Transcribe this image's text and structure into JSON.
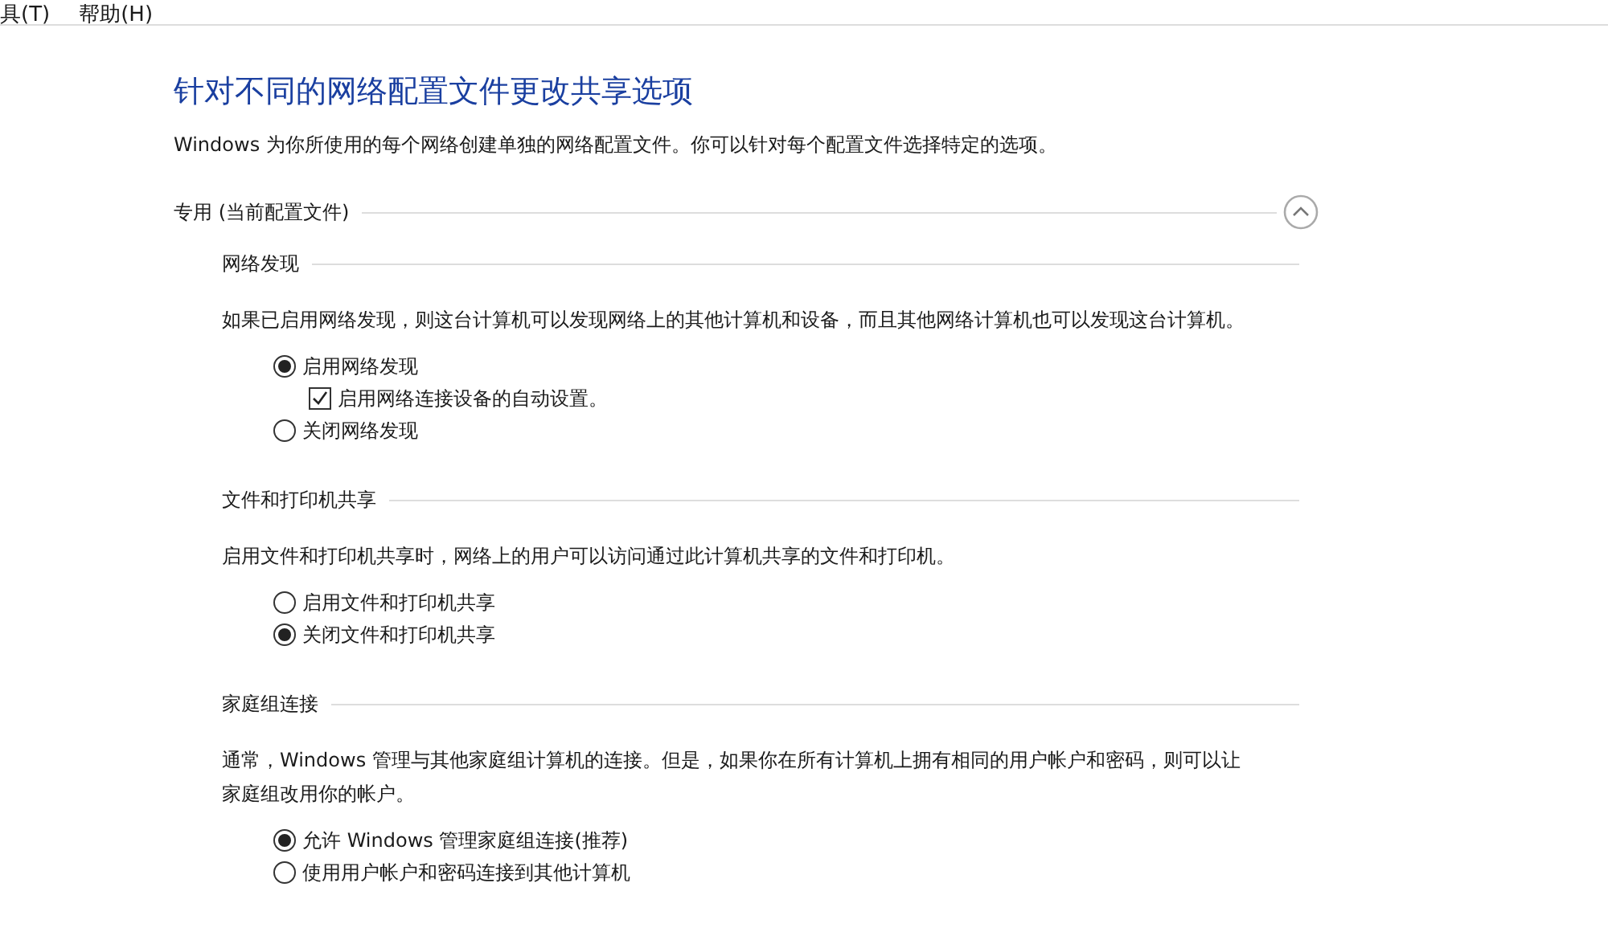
{
  "menu": [
    {
      "label": "具(T)"
    },
    {
      "label": "帮助(H)"
    }
  ],
  "title": "针对不同的网络配置文件更改共享选项",
  "description": "Windows 为你所使用的每个网络创建单独的网络配置文件。你可以针对每个配置文件选择特定的选项。",
  "profile": {
    "label": "专用 (当前配置文件)",
    "expanded": true,
    "sections": [
      {
        "heading": "网络发现",
        "description": "如果已启用网络发现，则这台计算机可以发现网络上的其他计算机和设备，而且其他网络计算机也可以发现这台计算机。",
        "options": [
          {
            "kind": "radio",
            "label": "启用网络发现",
            "selected": true,
            "children": [
              {
                "kind": "checkbox",
                "label": "启用网络连接设备的自动设置。",
                "checked": true
              }
            ]
          },
          {
            "kind": "radio",
            "label": "关闭网络发现",
            "selected": false
          }
        ]
      },
      {
        "heading": "文件和打印机共享",
        "description": "启用文件和打印机共享时，网络上的用户可以访问通过此计算机共享的文件和打印机。",
        "options": [
          {
            "kind": "radio",
            "label": "启用文件和打印机共享",
            "selected": false
          },
          {
            "kind": "radio",
            "label": "关闭文件和打印机共享",
            "selected": true
          }
        ]
      },
      {
        "heading": "家庭组连接",
        "description": "通常，Windows 管理与其他家庭组计算机的连接。但是，如果你在所有计算机上拥有相同的用户帐户和密码，则可以让家庭组改用你的帐户。",
        "options": [
          {
            "kind": "radio",
            "label": "允许 Windows 管理家庭组连接(推荐)",
            "selected": true
          },
          {
            "kind": "radio",
            "label": "使用用户帐户和密码连接到其他计算机",
            "selected": false
          }
        ]
      }
    ]
  }
}
